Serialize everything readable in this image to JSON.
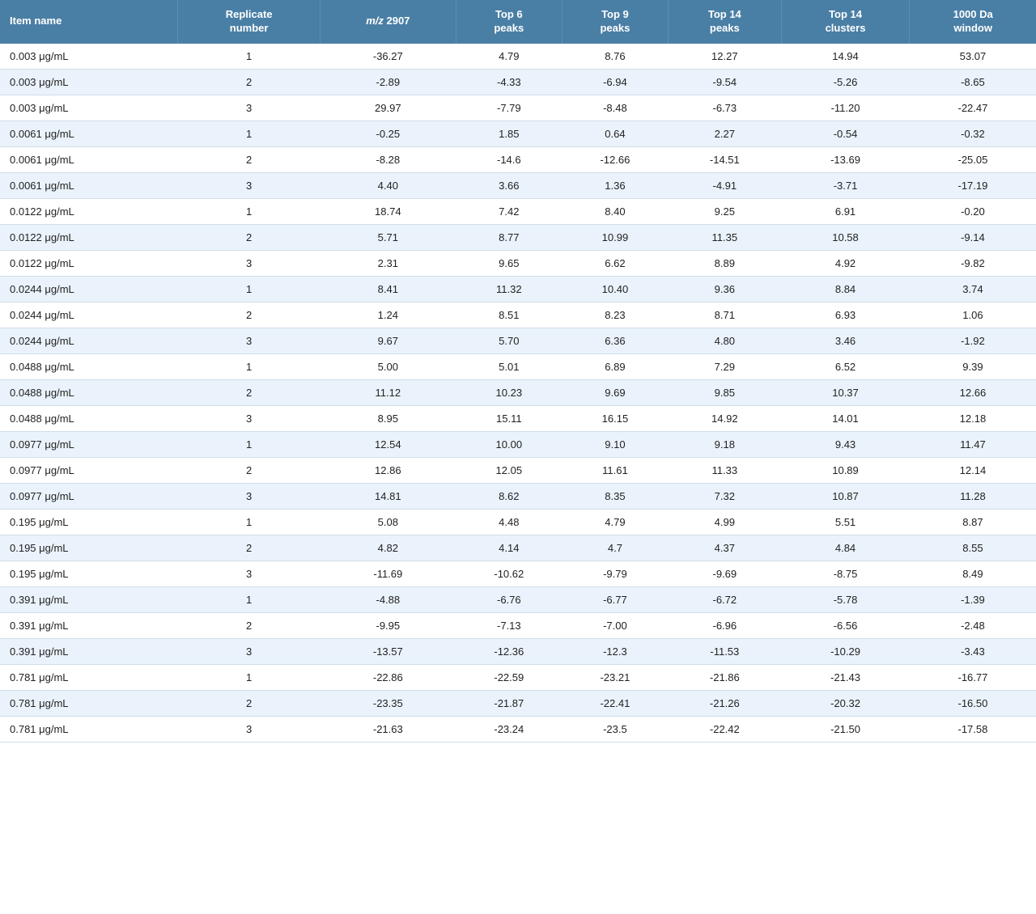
{
  "table": {
    "headers": [
      {
        "id": "item-name",
        "label": "Item name"
      },
      {
        "id": "replicate-number",
        "label": "Replicate\nnumber"
      },
      {
        "id": "mz-2907",
        "label": "m/z 2907",
        "italic": true
      },
      {
        "id": "top6-peaks",
        "label": "Top 6\npeaks"
      },
      {
        "id": "top9-peaks",
        "label": "Top 9\npeaks"
      },
      {
        "id": "top14-peaks",
        "label": "Top 14\npeaks"
      },
      {
        "id": "top14-clusters",
        "label": "Top 14\nclusters"
      },
      {
        "id": "1000da-window",
        "label": "1000 Da\nwindow"
      }
    ],
    "rows": [
      {
        "item": "0.003 μg/mL",
        "rep": "1",
        "mz": "-36.27",
        "top6": "4.79",
        "top9": "8.76",
        "top14p": "12.27",
        "top14c": "14.94",
        "da": "53.07"
      },
      {
        "item": "0.003 μg/mL",
        "rep": "2",
        "mz": "-2.89",
        "top6": "-4.33",
        "top9": "-6.94",
        "top14p": "-9.54",
        "top14c": "-5.26",
        "da": "-8.65"
      },
      {
        "item": "0.003 μg/mL",
        "rep": "3",
        "mz": "29.97",
        "top6": "-7.79",
        "top9": "-8.48",
        "top14p": "-6.73",
        "top14c": "-11.20",
        "da": "-22.47"
      },
      {
        "item": "0.0061 μg/mL",
        "rep": "1",
        "mz": "-0.25",
        "top6": "1.85",
        "top9": "0.64",
        "top14p": "2.27",
        "top14c": "-0.54",
        "da": "-0.32"
      },
      {
        "item": "0.0061 μg/mL",
        "rep": "2",
        "mz": "-8.28",
        "top6": "-14.6",
        "top9": "-12.66",
        "top14p": "-14.51",
        "top14c": "-13.69",
        "da": "-25.05"
      },
      {
        "item": "0.0061 μg/mL",
        "rep": "3",
        "mz": "4.40",
        "top6": "3.66",
        "top9": "1.36",
        "top14p": "-4.91",
        "top14c": "-3.71",
        "da": "-17.19"
      },
      {
        "item": "0.0122 μg/mL",
        "rep": "1",
        "mz": "18.74",
        "top6": "7.42",
        "top9": "8.40",
        "top14p": "9.25",
        "top14c": "6.91",
        "da": "-0.20"
      },
      {
        "item": "0.0122 μg/mL",
        "rep": "2",
        "mz": "5.71",
        "top6": "8.77",
        "top9": "10.99",
        "top14p": "11.35",
        "top14c": "10.58",
        "da": "-9.14"
      },
      {
        "item": "0.0122 μg/mL",
        "rep": "3",
        "mz": "2.31",
        "top6": "9.65",
        "top9": "6.62",
        "top14p": "8.89",
        "top14c": "4.92",
        "da": "-9.82"
      },
      {
        "item": "0.0244 μg/mL",
        "rep": "1",
        "mz": "8.41",
        "top6": "11.32",
        "top9": "10.40",
        "top14p": "9.36",
        "top14c": "8.84",
        "da": "3.74"
      },
      {
        "item": "0.0244 μg/mL",
        "rep": "2",
        "mz": "1.24",
        "top6": "8.51",
        "top9": "8.23",
        "top14p": "8.71",
        "top14c": "6.93",
        "da": "1.06"
      },
      {
        "item": "0.0244 μg/mL",
        "rep": "3",
        "mz": "9.67",
        "top6": "5.70",
        "top9": "6.36",
        "top14p": "4.80",
        "top14c": "3.46",
        "da": "-1.92"
      },
      {
        "item": "0.0488 μg/mL",
        "rep": "1",
        "mz": "5.00",
        "top6": "5.01",
        "top9": "6.89",
        "top14p": "7.29",
        "top14c": "6.52",
        "da": "9.39"
      },
      {
        "item": "0.0488 μg/mL",
        "rep": "2",
        "mz": "11.12",
        "top6": "10.23",
        "top9": "9.69",
        "top14p": "9.85",
        "top14c": "10.37",
        "da": "12.66"
      },
      {
        "item": "0.0488 μg/mL",
        "rep": "3",
        "mz": "8.95",
        "top6": "15.11",
        "top9": "16.15",
        "top14p": "14.92",
        "top14c": "14.01",
        "da": "12.18"
      },
      {
        "item": "0.0977 μg/mL",
        "rep": "1",
        "mz": "12.54",
        "top6": "10.00",
        "top9": "9.10",
        "top14p": "9.18",
        "top14c": "9.43",
        "da": "11.47"
      },
      {
        "item": "0.0977 μg/mL",
        "rep": "2",
        "mz": "12.86",
        "top6": "12.05",
        "top9": "11.61",
        "top14p": "11.33",
        "top14c": "10.89",
        "da": "12.14"
      },
      {
        "item": "0.0977 μg/mL",
        "rep": "3",
        "mz": "14.81",
        "top6": "8.62",
        "top9": "8.35",
        "top14p": "7.32",
        "top14c": "10.87",
        "da": "11.28"
      },
      {
        "item": "0.195 μg/mL",
        "rep": "1",
        "mz": "5.08",
        "top6": "4.48",
        "top9": "4.79",
        "top14p": "4.99",
        "top14c": "5.51",
        "da": "8.87"
      },
      {
        "item": "0.195 μg/mL",
        "rep": "2",
        "mz": "4.82",
        "top6": "4.14",
        "top9": "4.7",
        "top14p": "4.37",
        "top14c": "4.84",
        "da": "8.55"
      },
      {
        "item": "0.195 μg/mL",
        "rep": "3",
        "mz": "-11.69",
        "top6": "-10.62",
        "top9": "-9.79",
        "top14p": "-9.69",
        "top14c": "-8.75",
        "da": "8.49"
      },
      {
        "item": "0.391 μg/mL",
        "rep": "1",
        "mz": "-4.88",
        "top6": "-6.76",
        "top9": "-6.77",
        "top14p": "-6.72",
        "top14c": "-5.78",
        "da": "-1.39"
      },
      {
        "item": "0.391 μg/mL",
        "rep": "2",
        "mz": "-9.95",
        "top6": "-7.13",
        "top9": "-7.00",
        "top14p": "-6.96",
        "top14c": "-6.56",
        "da": "-2.48"
      },
      {
        "item": "0.391 μg/mL",
        "rep": "3",
        "mz": "-13.57",
        "top6": "-12.36",
        "top9": "-12.3",
        "top14p": "-11.53",
        "top14c": "-10.29",
        "da": "-3.43"
      },
      {
        "item": "0.781 μg/mL",
        "rep": "1",
        "mz": "-22.86",
        "top6": "-22.59",
        "top9": "-23.21",
        "top14p": "-21.86",
        "top14c": "-21.43",
        "da": "-16.77"
      },
      {
        "item": "0.781 μg/mL",
        "rep": "2",
        "mz": "-23.35",
        "top6": "-21.87",
        "top9": "-22.41",
        "top14p": "-21.26",
        "top14c": "-20.32",
        "da": "-16.50"
      },
      {
        "item": "0.781 μg/mL",
        "rep": "3",
        "mz": "-21.63",
        "top6": "-23.24",
        "top9": "-23.5",
        "top14p": "-22.42",
        "top14c": "-21.50",
        "da": "-17.58"
      }
    ]
  }
}
